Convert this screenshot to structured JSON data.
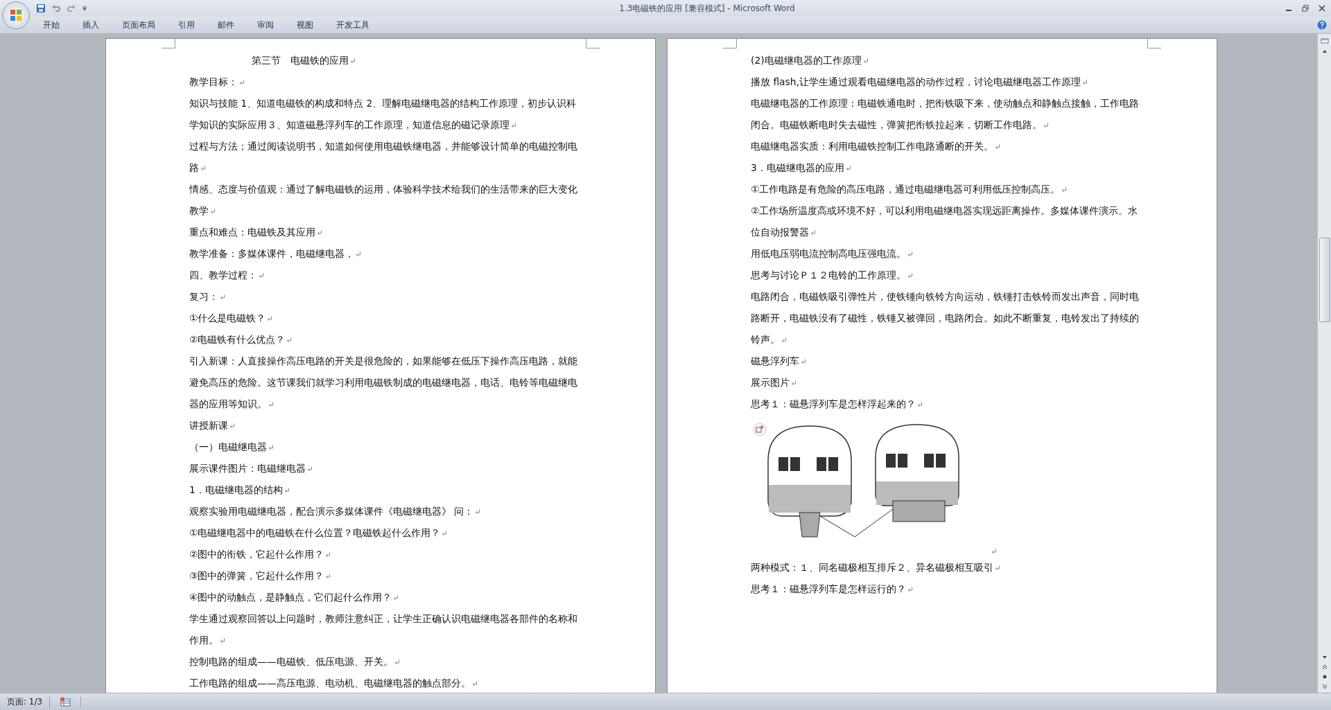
{
  "window": {
    "title": "1.3电磁铁的应用 [兼容模式] - Microsoft Word"
  },
  "ribbon_tabs": [
    {
      "label": "开始",
      "selected": false
    },
    {
      "label": "插入",
      "selected": false
    },
    {
      "label": "页面布局",
      "selected": false
    },
    {
      "label": "引用",
      "selected": false
    },
    {
      "label": "邮件",
      "selected": false
    },
    {
      "label": "审阅",
      "selected": false
    },
    {
      "label": "视图",
      "selected": false
    },
    {
      "label": "开发工具",
      "selected": false
    }
  ],
  "pages": [
    {
      "paragraphs": [
        {
          "kind": "title",
          "text": "第三节　电磁铁的应用"
        },
        {
          "kind": "text",
          "text": "教学目标："
        },
        {
          "kind": "text",
          "text": "知识与技能 1、知道电磁铁的构成和特点 2、理解电磁继电器的结构工作原理，初步认识科学知识的实际应用３、知道磁悬浮列车的工作原理，知道信息的磁记录原理"
        },
        {
          "kind": "text",
          "text": "过程与方法；通过阅读说明书，知道如何使用电磁铁继电器，并能够设计简单的电磁控制电路"
        },
        {
          "kind": "text",
          "text": "情感、态度与价值观：通过了解电磁铁的运用，体验科学技术给我们的生活带来的巨大变化教学"
        },
        {
          "kind": "text",
          "text": "重点和难点：电磁铁及其应用"
        },
        {
          "kind": "text",
          "text": "教学准备：多媒体课件，电磁继电器，"
        },
        {
          "kind": "text",
          "text": "四、教学过程："
        },
        {
          "kind": "text",
          "text": "复习："
        },
        {
          "kind": "text",
          "text": "①什么是电磁铁？"
        },
        {
          "kind": "text",
          "text": "②电磁铁有什么优点？"
        },
        {
          "kind": "text",
          "text": "引入新课：人直接操作高压电路的开关是很危险的，如果能够在低压下操作高压电路，就能避免高压的危险。这节课我们就学习利用电磁铁制成的电磁继电器，电话、电铃等电磁继电器的应用等知识。"
        },
        {
          "kind": "text",
          "text": "讲授新课"
        },
        {
          "kind": "text",
          "text": "（一）电磁继电器"
        },
        {
          "kind": "text",
          "text": "展示课件图片：电磁继电器"
        },
        {
          "kind": "text",
          "text": "1．电磁继电器的结构"
        },
        {
          "kind": "text",
          "text": "观察实验用电磁继电器，配合演示多媒体课件《电磁继电器》 问："
        },
        {
          "kind": "text",
          "text": "①电磁继电器中的电磁铁在什么位置？电磁铁起什么作用？"
        },
        {
          "kind": "text",
          "text": "②图中的衔铁，它起什么作用？"
        },
        {
          "kind": "text",
          "text": "③图中的弹簧，它起什么作用？"
        },
        {
          "kind": "text",
          "text": "④图中的动触点，是静触点，它们起什么作用？"
        },
        {
          "kind": "text",
          "text": "学生通过观察回答以上问题时，教师注意纠正，让学生正确认识电磁继电器各部件的名称和作用。"
        },
        {
          "kind": "text",
          "text": "控制电路的组成——电磁铁、低压电源、开关。"
        },
        {
          "kind": "text",
          "text": "工作电路的组成——高压电源、电动机、电磁继电器的触点部分。"
        }
      ]
    },
    {
      "paragraphs": [
        {
          "kind": "text",
          "text": "(2)电磁继电器的工作原理"
        },
        {
          "kind": "text",
          "text": "播放 flash,让学生通过观看电磁继电器的动作过程，讨论电磁继电器工作原理"
        },
        {
          "kind": "text",
          "text": "电磁继电器的工作原理：电磁铁通电时，把衔铁吸下来，使动触点和静触点接触，工作电路闭合。电磁铁断电时失去磁性，弹簧把衔铁拉起来，切断工作电路。"
        },
        {
          "kind": "text",
          "text": "电磁继电器实质：利用电磁铁控制工作电路通断的开关。"
        },
        {
          "kind": "text",
          "text": "3．电磁继电器的应用"
        },
        {
          "kind": "text",
          "text": "①工作电路是有危险的高压电路，通过电磁继电器可利用低压控制高压。"
        },
        {
          "kind": "text",
          "text": "②工作场所温度高或环境不好，可以利用电磁继电器实现远距离操作。多媒体课件演示。水位自动报警器"
        },
        {
          "kind": "text",
          "text": "用低电压弱电流控制高电压强电流。"
        },
        {
          "kind": "text",
          "text": "思考与讨论Ｐ１２电铃的工作原理。"
        },
        {
          "kind": "text",
          "text": "电路闭合，电磁铁吸引弹性片，使铁锤向铁铃方向运动，铁锤打击铁铃而发出声音，同时电路断开，电磁铁没有了磁性，铁锤又被弹回，电路闭合。如此不断重复，电铃发出了持续的铃声。"
        },
        {
          "kind": "text",
          "text": "磁悬浮列车"
        },
        {
          "kind": "text",
          "text": "展示图片"
        },
        {
          "kind": "text",
          "text": "思考１：磁悬浮列车是怎样浮起来的？"
        },
        {
          "kind": "figure"
        },
        {
          "kind": "text",
          "text": "两种模式：１、同名磁极相互排斥２、异名磁极相互吸引"
        },
        {
          "kind": "text",
          "text": "思考１：磁悬浮列车是怎样运行的？"
        }
      ]
    }
  ],
  "status_bar": {
    "page": "页面: 1/3"
  }
}
